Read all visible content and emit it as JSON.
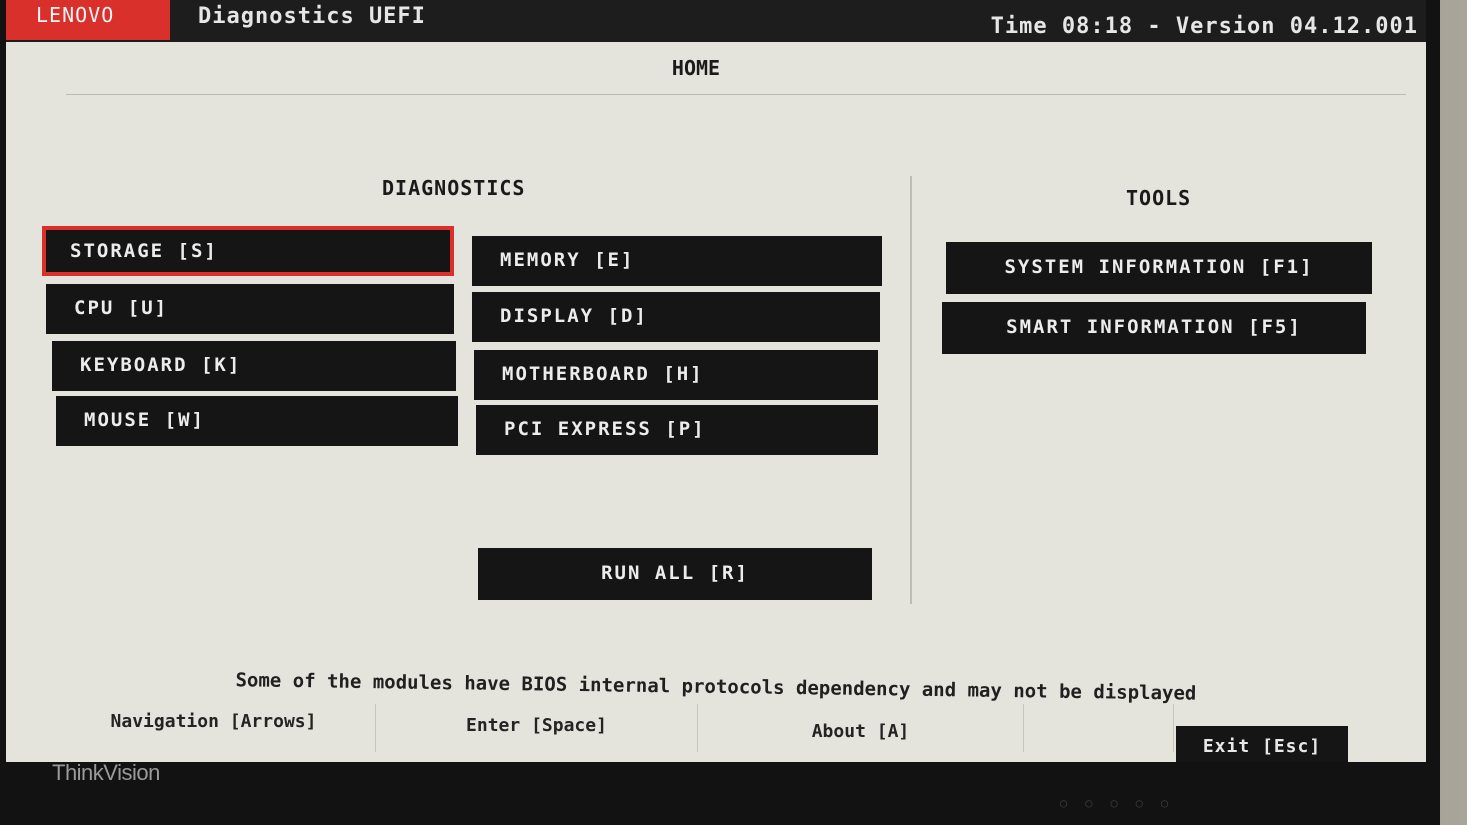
{
  "window": {
    "brand": "LENOVO",
    "title": "Diagnostics UEFI",
    "time_version": "Time 08:18 - Version 04.12.001"
  },
  "page": {
    "title": "HOME"
  },
  "diagnostics": {
    "title": "DIAGNOSTICS",
    "storage": "STORAGE [S]",
    "cpu": "CPU [U]",
    "keyboard": "KEYBOARD [K]",
    "mouse": "MOUSE [W]",
    "memory": "MEMORY [E]",
    "display": "DISPLAY [D]",
    "motherboard": "MOTHERBOARD [H]",
    "pci_express": "PCI EXPRESS [P]",
    "run_all": "RUN ALL [R]",
    "selected": "STORAGE [S]"
  },
  "tools": {
    "title": "TOOLS",
    "system_information": "SYSTEM INFORMATION [F1]",
    "smart_information": "SMART INFORMATION [F5]"
  },
  "notice": "Some of the modules have BIOS internal protocols dependency and may not be displayed",
  "footer": {
    "navigation": "Navigation [Arrows]",
    "enter": "Enter [Space]",
    "about": "About [A]",
    "exit": "Exit [Esc]"
  },
  "monitor": {
    "logo": "ThinkVision"
  },
  "colors": {
    "accent": "#d9302c",
    "button_bg": "#151515",
    "screen_bg": "#e4e4dc"
  }
}
